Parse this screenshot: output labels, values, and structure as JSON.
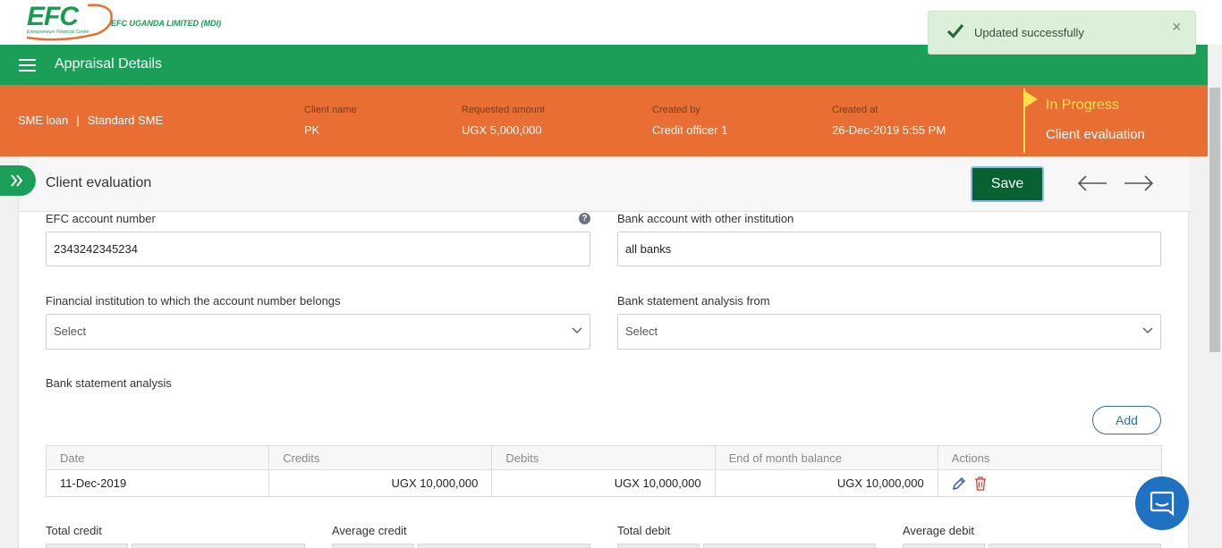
{
  "brand": {
    "logo_text": "EFC",
    "logo_tagline": "Entrepreneurs Financial Centre",
    "company_name": "EFC UGANDA LIMITED (MDI)"
  },
  "toast": {
    "message": "Updated successfully",
    "close_glyph": "×"
  },
  "header": {
    "title": "Appraisal Details"
  },
  "loan": {
    "product": "SME loan",
    "separator": "|",
    "variant": "Standard SME",
    "client_name_label": "Client name",
    "client_name": "PK",
    "requested_amount_label": "Requested amount",
    "requested_amount": "UGX 5,000,000",
    "created_by_label": "Created by",
    "created_by": "Credit officer 1",
    "created_at_label": "Created at",
    "created_at": "26-Dec-2019 5:55 PM",
    "status": "In Progress",
    "step": "Client evaluation"
  },
  "section": {
    "title": "Client evaluation",
    "save_label": "Save"
  },
  "form": {
    "efc_account_label": "EFC account number",
    "efc_account_value": "2343242345234",
    "bank_account_label": "Bank account with other institution",
    "bank_account_value": "all banks",
    "institution_label": "Financial institution to which the account number belongs",
    "institution_placeholder": "Select",
    "analysis_from_label": "Bank statement analysis from",
    "analysis_from_placeholder": "Select",
    "analysis_label": "Bank statement analysis",
    "add_label": "Add"
  },
  "table": {
    "columns": [
      "Date",
      "Credits",
      "Debits",
      "End of month balance",
      "Actions"
    ],
    "rows": [
      {
        "date": "11-Dec-2019",
        "credits": "UGX 10,000,000",
        "debits": "UGX 10,000,000",
        "balance": "UGX 10,000,000"
      }
    ]
  },
  "totals": {
    "total_credit_label": "Total credit",
    "average_credit_label": "Average credit",
    "total_debit_label": "Total debit",
    "average_debit_label": "Average debit"
  },
  "colors": {
    "green": "#1b9e57",
    "orange": "#e86e33",
    "status_yellow": "#fbe04a",
    "save_green": "#086131",
    "link_blue": "#2f6fa0"
  },
  "icons": [
    "check-icon",
    "close-icon",
    "menu-icon",
    "left-arrow-icon",
    "right-arrow-icon",
    "chevron-down-icon",
    "help-icon",
    "edit-icon",
    "delete-icon",
    "expand-icon",
    "chat-icon"
  ]
}
